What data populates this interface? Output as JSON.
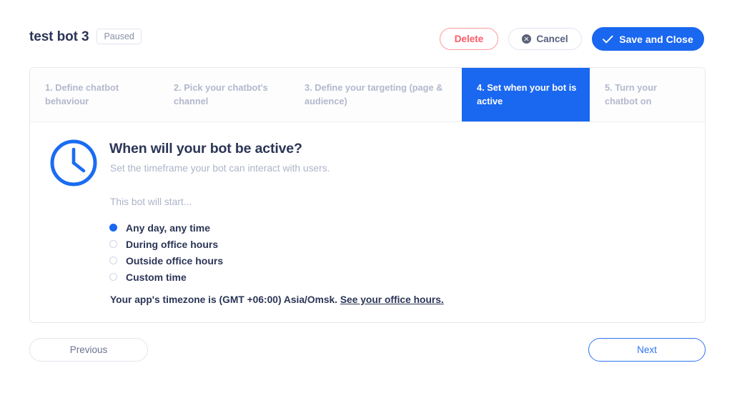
{
  "header": {
    "bot_title": "test bot 3",
    "status_badge": "Paused",
    "delete_label": "Delete",
    "cancel_label": "Cancel",
    "save_label": "Save and Close",
    "cancel_icon": "x-circle-icon",
    "save_icon": "check-icon"
  },
  "steps": [
    {
      "label": "1. Define chatbot behaviour",
      "active": false
    },
    {
      "label": "2. Pick your chatbot's channel",
      "active": false
    },
    {
      "label": "3. Define your targeting (page & audience)",
      "active": false
    },
    {
      "label": "4. Set when your bot is active",
      "active": true
    },
    {
      "label": "5. Turn your chatbot on",
      "active": false
    }
  ],
  "panel": {
    "icon": "clock-icon",
    "title": "When will your bot be active?",
    "subtitle": "Set the timeframe your bot can interact with users.",
    "field_label": "This bot will start...",
    "options": [
      {
        "label": "Any day, any time",
        "selected": true
      },
      {
        "label": "During office hours",
        "selected": false
      },
      {
        "label": "Outside office hours",
        "selected": false
      },
      {
        "label": "Custom time",
        "selected": false
      }
    ],
    "timezone_text": "Your app's timezone is (GMT +06:00) Asia/Omsk.",
    "timezone_link": "See your office hours."
  },
  "footer": {
    "previous_label": "Previous",
    "next_label": "Next"
  },
  "colors": {
    "accent_blue": "#1a67f0",
    "danger_red": "#ff5a64",
    "text_dark": "#2b3556",
    "text_muted": "#aeb4c8",
    "step_muted": "#b3b8cc"
  }
}
